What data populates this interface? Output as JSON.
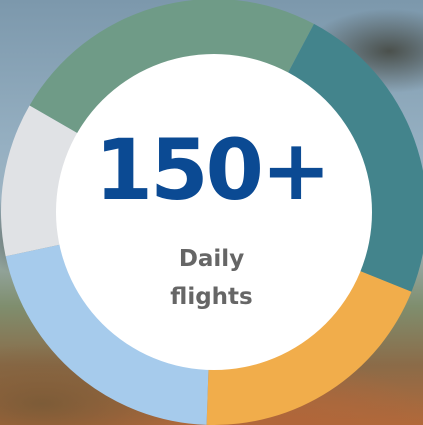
{
  "stat": {
    "value": "150+",
    "caption_line_1": "Daily",
    "caption_line_2": "flights"
  },
  "colors": {
    "value_text": "#0b4a93",
    "caption_text": "#666666",
    "inner_disc": "#ffffff"
  },
  "ring_segments": [
    {
      "name": "segment-sage",
      "color": "#6f9b87",
      "start_deg": -60,
      "end_deg": 28
    },
    {
      "name": "segment-teal",
      "color": "#43848c",
      "start_deg": 28,
      "end_deg": 112
    },
    {
      "name": "segment-amber",
      "color": "#f1ad4b",
      "start_deg": 112,
      "end_deg": 182
    },
    {
      "name": "segment-light-blue",
      "color": "#a6cbec",
      "start_deg": 182,
      "end_deg": 258
    },
    {
      "name": "segment-light-gray",
      "color": "#e0e2e5",
      "start_deg": 258,
      "end_deg": 300
    }
  ]
}
